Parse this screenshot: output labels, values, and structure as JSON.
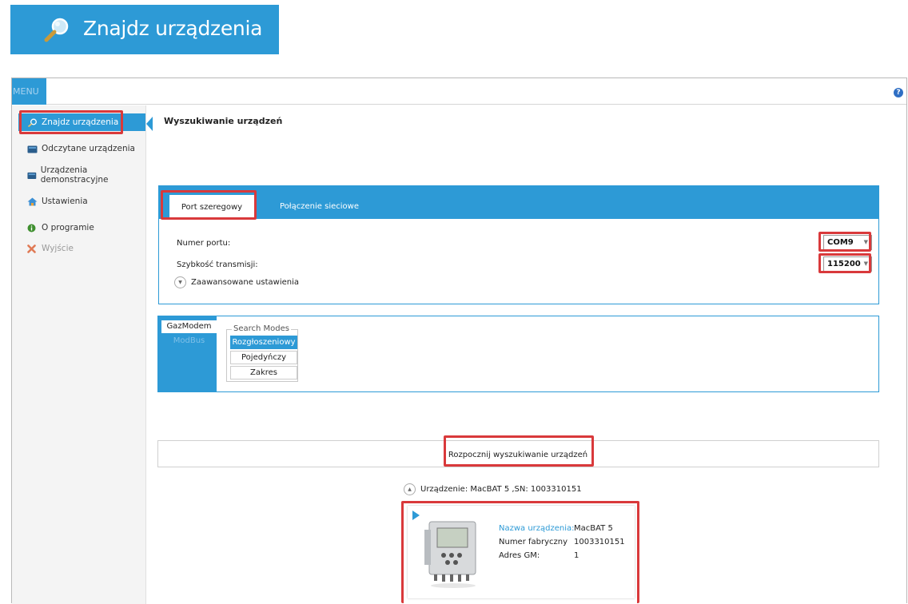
{
  "banner": {
    "title": "Znajdz urządzenia",
    "icon": "search-icon"
  },
  "topbar": {
    "menu_label": "MENU",
    "help_icon": "help-icon",
    "help_glyph": "?"
  },
  "sidebar": {
    "items": [
      {
        "label": "Znajdz urządzenia",
        "icon": "search-icon",
        "active": true
      },
      {
        "label": "Odczytane urządzenia",
        "icon": "device-icon"
      },
      {
        "label": "Urządzenia demonstracyjne",
        "icon": "device-icon"
      },
      {
        "label": "Ustawienia",
        "icon": "home-icon"
      },
      {
        "label": "O programie",
        "icon": "info-icon"
      },
      {
        "label": "Wyjście",
        "icon": "exit-icon"
      }
    ]
  },
  "main": {
    "title": "Wyszukiwanie urządzeń",
    "connection": {
      "tabs": [
        "Port szeregowy",
        "Połączenie sieciowe"
      ],
      "port_label": "Numer portu:",
      "port_value": "COM9",
      "baud_label": "Szybkość transmisji:",
      "baud_value": "115200",
      "advanced_label": "Zaawansowane ustawienia"
    },
    "protocol": {
      "tabs": [
        "GazModem",
        "ModBus"
      ],
      "legend": "Search Modes",
      "modes": [
        "Rozgłoszeniowy",
        "Pojedyńczy adres",
        "Zakres"
      ],
      "selected": "Rozgłoszeniowy"
    },
    "search_button": "Rozpocznij wyszukiwanie urządzeń",
    "result": {
      "header": "Urządzenie:  MacBAT 5  ,SN:  1003310151",
      "name_label": "Nazwa urządzenia:",
      "name_value": "MacBAT 5",
      "serial_label": "Numer fabryczny",
      "serial_value": "1003310151",
      "address_label": "Adres GM:",
      "address_value": "1"
    }
  },
  "colors": {
    "accent": "#2d9ad6",
    "highlight": "#d9393b",
    "link": "#2d9ad6"
  }
}
